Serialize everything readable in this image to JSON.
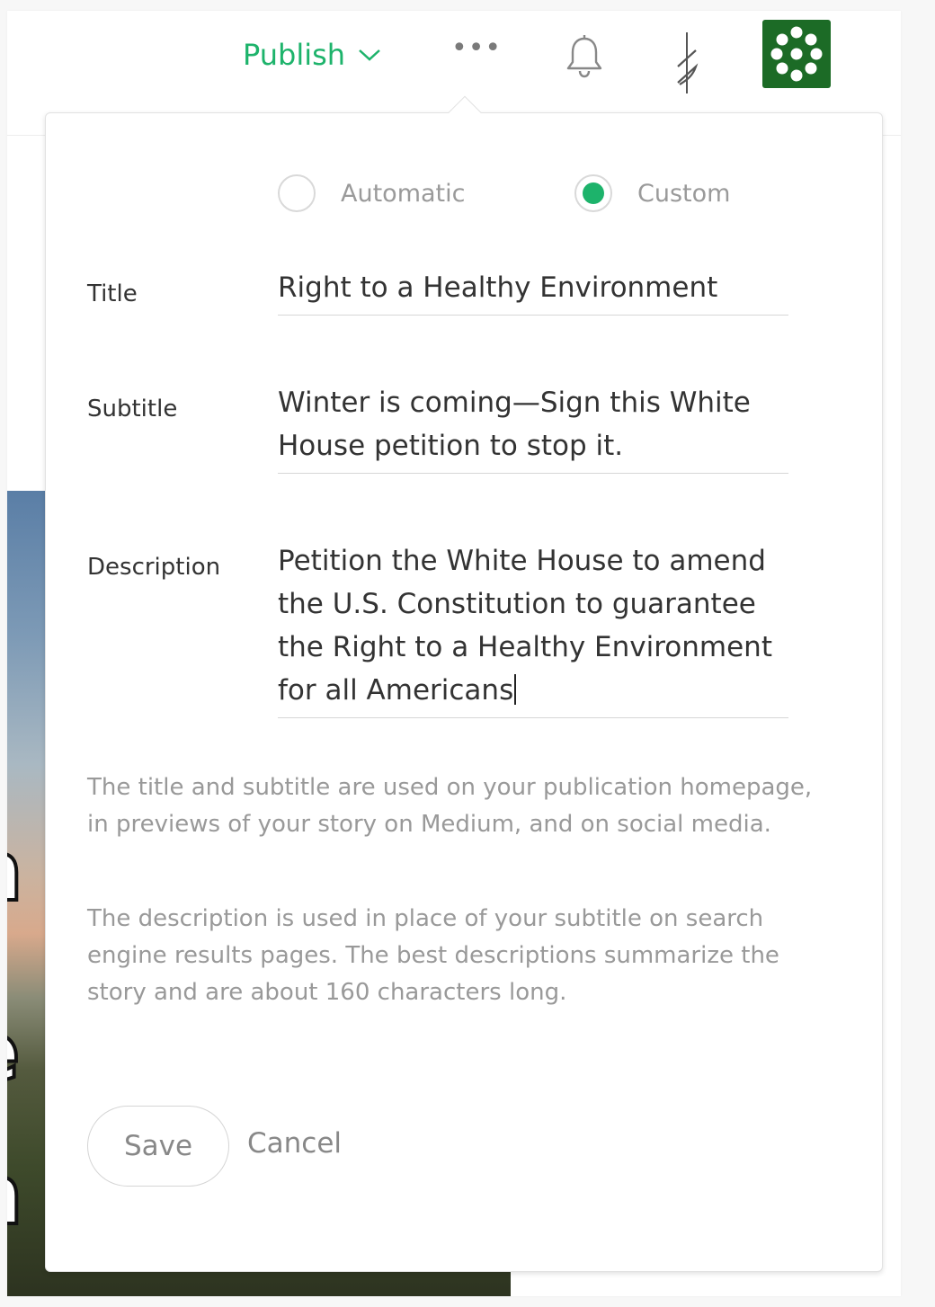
{
  "header": {
    "publish_label": "Publish",
    "more_label": "•••"
  },
  "mode": {
    "options": [
      {
        "label": "Automatic",
        "selected": false
      },
      {
        "label": "Custom",
        "selected": true
      }
    ]
  },
  "form": {
    "title_label": "Title",
    "title_value": "Right to a Healthy Environment",
    "subtitle_label": "Subtitle",
    "subtitle_value": "Winter is coming—Sign this White House petition to stop it.",
    "description_label": "Description",
    "description_value": "Petition the White House to amend the U.S. Constitution to guarantee the Right to a Healthy Environment for all Americans"
  },
  "help": {
    "title_help": "The title and subtitle are used on your publication homepage, in previews of your story on Medium, and on social media.",
    "description_help": "The description is used in place of your subtitle on search engine results pages. The best descriptions summarize the story and are about 160 characters long."
  },
  "actions": {
    "save_label": "Save",
    "cancel_label": "Cancel"
  },
  "colors": {
    "accent": "#1db36b",
    "avatar_bg": "#1c6b26"
  }
}
